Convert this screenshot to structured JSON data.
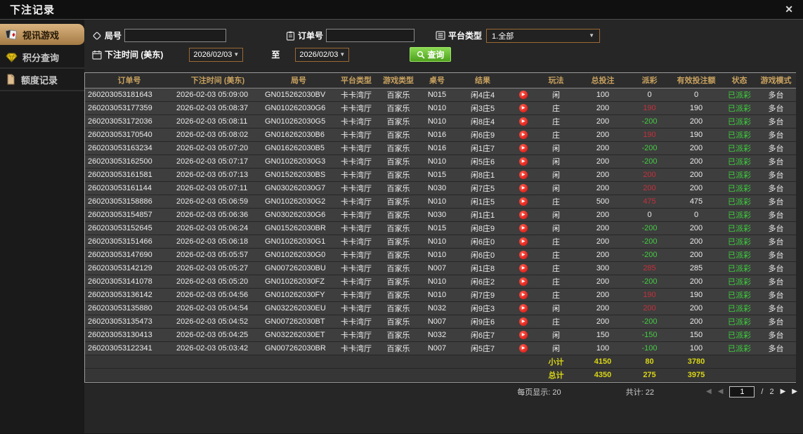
{
  "window": {
    "title": "下注记录"
  },
  "glyphs": {
    "close": "✕",
    "dropdown_arrow": "▼",
    "play": "▶",
    "first": "◀",
    "prev": "◀",
    "next": "▶",
    "last": "▶"
  },
  "sidebar": {
    "items": [
      {
        "label": "视讯游戏",
        "icon": "cards-icon",
        "selected": true
      },
      {
        "label": "积分查询",
        "icon": "diamond-icon",
        "selected": false
      },
      {
        "label": "额度记录",
        "icon": "document-icon",
        "selected": false
      }
    ]
  },
  "filters": {
    "round_no": {
      "label": "局号",
      "value": ""
    },
    "order_no": {
      "label": "订单号",
      "value": ""
    },
    "platform_type": {
      "label": "平台类型",
      "value": "1.全部"
    },
    "bet_time": {
      "label": "下注时间 (美东)",
      "from": "2026/02/03",
      "to_label": "至",
      "to": "2026/02/03"
    },
    "query_button": {
      "label": "查询"
    }
  },
  "table": {
    "columns": [
      "订单号",
      "下注时间 (美东)",
      "局号",
      "平台类型",
      "游戏类型",
      "桌号",
      "结果",
      "",
      "玩法",
      "总投注",
      "派彩",
      "有效投注额",
      "状态",
      "游戏模式"
    ],
    "rows": [
      {
        "order_no": "260203053181643",
        "bet_time": "2026-02-03 05:09:00",
        "round_no": "GN015262030BV",
        "platform": "卡卡湾厅",
        "game_type": "百家乐",
        "table_no": "N015",
        "result": "闲4庄4",
        "play_method": "闲",
        "total_bet": "100",
        "payout": "0",
        "valid_bet": "0",
        "status": "已派彩",
        "game_mode": "多台"
      },
      {
        "order_no": "260203053177359",
        "bet_time": "2026-02-03 05:08:37",
        "round_no": "GN010262030G6",
        "platform": "卡卡湾厅",
        "game_type": "百家乐",
        "table_no": "N010",
        "result": "闲3庄5",
        "play_method": "庄",
        "total_bet": "200",
        "payout": "190",
        "valid_bet": "190",
        "status": "已派彩",
        "game_mode": "多台"
      },
      {
        "order_no": "260203053172036",
        "bet_time": "2026-02-03 05:08:11",
        "round_no": "GN010262030G5",
        "platform": "卡卡湾厅",
        "game_type": "百家乐",
        "table_no": "N010",
        "result": "闲8庄4",
        "play_method": "庄",
        "total_bet": "200",
        "payout": "-200",
        "valid_bet": "200",
        "status": "已派彩",
        "game_mode": "多台"
      },
      {
        "order_no": "260203053170540",
        "bet_time": "2026-02-03 05:08:02",
        "round_no": "GN016262030B6",
        "platform": "卡卡湾厅",
        "game_type": "百家乐",
        "table_no": "N016",
        "result": "闲6庄9",
        "play_method": "庄",
        "total_bet": "200",
        "payout": "190",
        "valid_bet": "190",
        "status": "已派彩",
        "game_mode": "多台"
      },
      {
        "order_no": "260203053163234",
        "bet_time": "2026-02-03 05:07:20",
        "round_no": "GN016262030B5",
        "platform": "卡卡湾厅",
        "game_type": "百家乐",
        "table_no": "N016",
        "result": "闲1庄7",
        "play_method": "闲",
        "total_bet": "200",
        "payout": "-200",
        "valid_bet": "200",
        "status": "已派彩",
        "game_mode": "多台"
      },
      {
        "order_no": "260203053162500",
        "bet_time": "2026-02-03 05:07:17",
        "round_no": "GN010262030G3",
        "platform": "卡卡湾厅",
        "game_type": "百家乐",
        "table_no": "N010",
        "result": "闲5庄6",
        "play_method": "闲",
        "total_bet": "200",
        "payout": "-200",
        "valid_bet": "200",
        "status": "已派彩",
        "game_mode": "多台"
      },
      {
        "order_no": "260203053161581",
        "bet_time": "2026-02-03 05:07:13",
        "round_no": "GN015262030BS",
        "platform": "卡卡湾厅",
        "game_type": "百家乐",
        "table_no": "N015",
        "result": "闲8庄1",
        "play_method": "闲",
        "total_bet": "200",
        "payout": "200",
        "valid_bet": "200",
        "status": "已派彩",
        "game_mode": "多台"
      },
      {
        "order_no": "260203053161144",
        "bet_time": "2026-02-03 05:07:11",
        "round_no": "GN030262030G7",
        "platform": "卡卡湾厅",
        "game_type": "百家乐",
        "table_no": "N030",
        "result": "闲7庄5",
        "play_method": "闲",
        "total_bet": "200",
        "payout": "200",
        "valid_bet": "200",
        "status": "已派彩",
        "game_mode": "多台"
      },
      {
        "order_no": "260203053158886",
        "bet_time": "2026-02-03 05:06:59",
        "round_no": "GN010262030G2",
        "platform": "卡卡湾厅",
        "game_type": "百家乐",
        "table_no": "N010",
        "result": "闲1庄5",
        "play_method": "庄",
        "total_bet": "500",
        "payout": "475",
        "valid_bet": "475",
        "status": "已派彩",
        "game_mode": "多台"
      },
      {
        "order_no": "260203053154857",
        "bet_time": "2026-02-03 05:06:36",
        "round_no": "GN030262030G6",
        "platform": "卡卡湾厅",
        "game_type": "百家乐",
        "table_no": "N030",
        "result": "闲1庄1",
        "play_method": "闲",
        "total_bet": "200",
        "payout": "0",
        "valid_bet": "0",
        "status": "已派彩",
        "game_mode": "多台"
      },
      {
        "order_no": "260203053152645",
        "bet_time": "2026-02-03 05:06:24",
        "round_no": "GN015262030BR",
        "platform": "卡卡湾厅",
        "game_type": "百家乐",
        "table_no": "N015",
        "result": "闲8庄9",
        "play_method": "闲",
        "total_bet": "200",
        "payout": "-200",
        "valid_bet": "200",
        "status": "已派彩",
        "game_mode": "多台"
      },
      {
        "order_no": "260203053151466",
        "bet_time": "2026-02-03 05:06:18",
        "round_no": "GN010262030G1",
        "platform": "卡卡湾厅",
        "game_type": "百家乐",
        "table_no": "N010",
        "result": "闲6庄0",
        "play_method": "庄",
        "total_bet": "200",
        "payout": "-200",
        "valid_bet": "200",
        "status": "已派彩",
        "game_mode": "多台"
      },
      {
        "order_no": "260203053147690",
        "bet_time": "2026-02-03 05:05:57",
        "round_no": "GN010262030G0",
        "platform": "卡卡湾厅",
        "game_type": "百家乐",
        "table_no": "N010",
        "result": "闲6庄0",
        "play_method": "庄",
        "total_bet": "200",
        "payout": "-200",
        "valid_bet": "200",
        "status": "已派彩",
        "game_mode": "多台"
      },
      {
        "order_no": "260203053142129",
        "bet_time": "2026-02-03 05:05:27",
        "round_no": "GN007262030BU",
        "platform": "卡卡湾厅",
        "game_type": "百家乐",
        "table_no": "N007",
        "result": "闲1庄8",
        "play_method": "庄",
        "total_bet": "300",
        "payout": "285",
        "valid_bet": "285",
        "status": "已派彩",
        "game_mode": "多台"
      },
      {
        "order_no": "260203053141078",
        "bet_time": "2026-02-03 05:05:20",
        "round_no": "GN010262030FZ",
        "platform": "卡卡湾厅",
        "game_type": "百家乐",
        "table_no": "N010",
        "result": "闲6庄2",
        "play_method": "庄",
        "total_bet": "200",
        "payout": "-200",
        "valid_bet": "200",
        "status": "已派彩",
        "game_mode": "多台"
      },
      {
        "order_no": "260203053136142",
        "bet_time": "2026-02-03 05:04:56",
        "round_no": "GN010262030FY",
        "platform": "卡卡湾厅",
        "game_type": "百家乐",
        "table_no": "N010",
        "result": "闲7庄9",
        "play_method": "庄",
        "total_bet": "200",
        "payout": "190",
        "valid_bet": "190",
        "status": "已派彩",
        "game_mode": "多台"
      },
      {
        "order_no": "260203053135880",
        "bet_time": "2026-02-03 05:04:54",
        "round_no": "GN032262030EU",
        "platform": "卡卡湾厅",
        "game_type": "百家乐",
        "table_no": "N032",
        "result": "闲9庄3",
        "play_method": "闲",
        "total_bet": "200",
        "payout": "200",
        "valid_bet": "200",
        "status": "已派彩",
        "game_mode": "多台"
      },
      {
        "order_no": "260203053135473",
        "bet_time": "2026-02-03 05:04:52",
        "round_no": "GN007262030BT",
        "platform": "卡卡湾厅",
        "game_type": "百家乐",
        "table_no": "N007",
        "result": "闲9庄6",
        "play_method": "庄",
        "total_bet": "200",
        "payout": "-200",
        "valid_bet": "200",
        "status": "已派彩",
        "game_mode": "多台"
      },
      {
        "order_no": "260203053130413",
        "bet_time": "2026-02-03 05:04:25",
        "round_no": "GN032262030ET",
        "platform": "卡卡湾厅",
        "game_type": "百家乐",
        "table_no": "N032",
        "result": "闲6庄7",
        "play_method": "闲",
        "total_bet": "150",
        "payout": "-150",
        "valid_bet": "150",
        "status": "已派彩",
        "game_mode": "多台"
      },
      {
        "order_no": "260203053122341",
        "bet_time": "2026-02-03 05:03:42",
        "round_no": "GN007262030BR",
        "platform": "卡卡湾厅",
        "game_type": "百家乐",
        "table_no": "N007",
        "result": "闲5庄7",
        "play_method": "闲",
        "total_bet": "100",
        "payout": "-100",
        "valid_bet": "100",
        "status": "已派彩",
        "game_mode": "多台"
      }
    ],
    "subtotal": {
      "label": "小计",
      "total_bet": "4150",
      "payout": "80",
      "valid_bet": "3780"
    },
    "grand_total": {
      "label": "总计",
      "total_bet": "4350",
      "payout": "275",
      "valid_bet": "3975"
    }
  },
  "footer": {
    "page_size_label": "每页显示: 20",
    "total_count_label": "共计: 22",
    "pagination": {
      "page_value": "1",
      "separator": "/",
      "total_pages": "2"
    }
  },
  "colors": {
    "accent_gold": "#c9a25f",
    "selected_tab": "#c9a06b",
    "positive_payout_red": "#c5303c",
    "negative_payout_green": "#42cd42",
    "status_green": "#3fd03f",
    "totals_yellow": "#d9d516",
    "query_green": "#64c23a",
    "date_border": "#9a6a33"
  }
}
